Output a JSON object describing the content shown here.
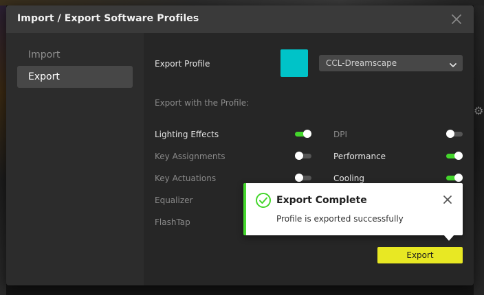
{
  "dialog": {
    "title": "Import / Export Software Profiles",
    "close_icon": "close-icon"
  },
  "sidebar": {
    "items": [
      {
        "label": "Import",
        "active": false
      },
      {
        "label": "Export",
        "active": true
      }
    ]
  },
  "export": {
    "profile_label": "Export Profile",
    "profile_color": "#00c3c8",
    "profile_selected": "CCL-Dreamscape",
    "section_label": "Export with the Profile:",
    "options_left": [
      {
        "label": "Lighting Effects",
        "enabled": true
      },
      {
        "label": "Key Assignments",
        "enabled": false
      },
      {
        "label": "Key Actuations",
        "enabled": false
      },
      {
        "label": "Equalizer",
        "enabled": false
      },
      {
        "label": "FlashTap",
        "enabled": false
      }
    ],
    "options_right": [
      {
        "label": "DPI",
        "enabled": false
      },
      {
        "label": "Performance",
        "enabled": true
      },
      {
        "label": "Cooling",
        "enabled": true
      }
    ],
    "button_label": "Export"
  },
  "toast": {
    "title": "Export Complete",
    "message": "Profile is exported successfully",
    "icon": "check-circle-icon",
    "accent_color": "#44d62c"
  },
  "colors": {
    "accent_green": "#44d62c",
    "export_button": "#e8e823"
  }
}
